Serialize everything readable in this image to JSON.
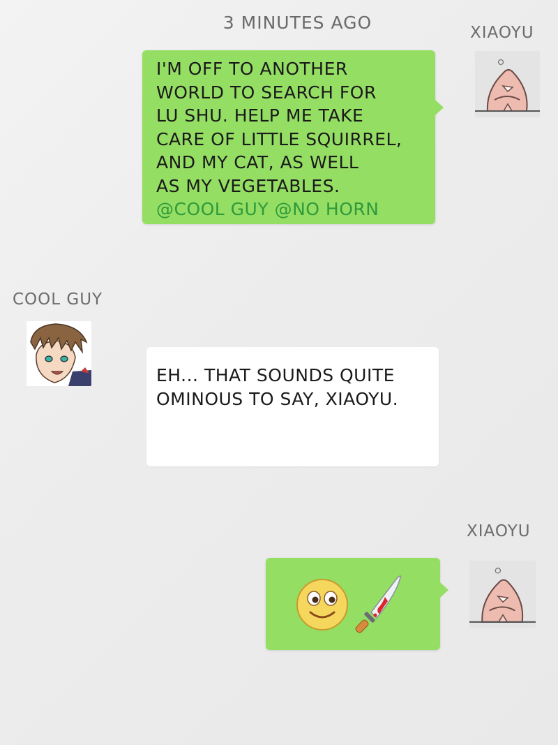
{
  "chat": {
    "timestamp": "3 MINUTES AGO",
    "messages": [
      {
        "sender": "XIAOYU",
        "avatar": "cartoon-face-icon",
        "lines": [
          "I'M OFF TO ANOTHER",
          "WORLD TO SEARCH FOR",
          "LU SHU. HELP ME TAKE",
          "CARE OF LITTLE SQUIRREL,",
          "AND MY CAT, AS WELL",
          "AS MY VEGETABLES."
        ],
        "mentions": "@COOL GUY @NO HORN",
        "bubble_color": "#95de64",
        "mention_color": "#2f9a3b"
      },
      {
        "sender": "COOL GUY",
        "avatar": "anime-boy-icon",
        "lines": [
          "EH... THAT SOUNDS QUITE",
          "OMINOUS TO SAY, XIAOYU."
        ],
        "bubble_color": "#ffffff"
      },
      {
        "sender": "XIAOYU",
        "avatar": "cartoon-face-icon",
        "emojis": [
          "smile-emoji-icon",
          "bloody-knife-icon"
        ],
        "bubble_color": "#95de64"
      }
    ]
  }
}
